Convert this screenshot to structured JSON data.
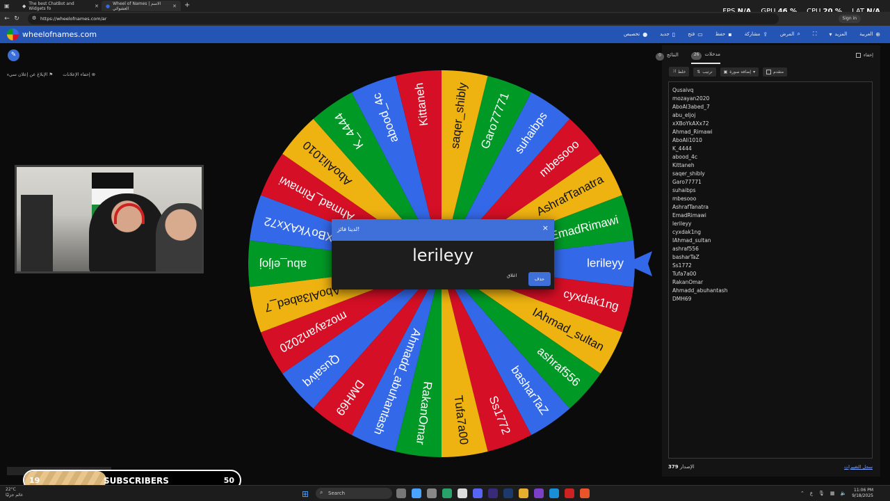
{
  "browser": {
    "tabs": [
      {
        "title": "The best ChatBot and Widgets fo",
        "active": false
      },
      {
        "title": "Wheel of Names | الاسم العشوائي",
        "active": true
      }
    ],
    "url": "https://wheelofnames.com/ar",
    "signin": "Sign in"
  },
  "overlay_stats": {
    "fps_label": "FPS",
    "fps_value": "N/A",
    "gpu_label": "GPU",
    "gpu_value": "46 %",
    "cpu_label": "CPU",
    "cpu_value": "20 %",
    "lat_label": "LAT",
    "lat_value": "N/A"
  },
  "site": {
    "title": "wheelofnames.com",
    "menu": [
      {
        "label": "العربية",
        "icon": "globe-icon"
      },
      {
        "label": "المزيد",
        "icon": "chevron-down-icon"
      },
      {
        "label": "",
        "icon": "fullscreen-icon"
      },
      {
        "label": "المرض",
        "icon": "search-icon"
      },
      {
        "label": "مشاركة",
        "icon": "share-icon"
      },
      {
        "label": "حفظ",
        "icon": "save-icon"
      },
      {
        "label": "فتح",
        "icon": "folder-icon"
      },
      {
        "label": "جديد",
        "icon": "file-icon"
      },
      {
        "label": "تخصيص",
        "icon": "palette-icon"
      }
    ]
  },
  "left": {
    "hide_ads": "إخفاء الإعلانات",
    "report_ad": "الإبلاغ عن إعلان سيء"
  },
  "wheel": {
    "colors": [
      "#3369e8",
      "#d50f25",
      "#eeb211",
      "#009925"
    ],
    "names": [
      "Qusaivq",
      "mozayan2020",
      "AboAl3abed_7",
      "abu_eljoj",
      "xXBoYkAXx72",
      "Ahmad_Rimawi",
      "AboAli1010",
      "K_4444",
      "abood_4c",
      "Kittaneh",
      "saqer_shibly",
      "Garo77771",
      "suhaibps",
      "mbesooo",
      "AshrafTanatra",
      "EmadRimawi",
      "lerileyy",
      "cyxdak1ng",
      "IAhmad_sultan",
      "ashraf556",
      "basharTaZ",
      "Ss1772",
      "Tufa7a00",
      "RakanOmar",
      "Ahmadd_abuhantash",
      "DMH69"
    ],
    "pointer_color": "#3369e8"
  },
  "dialog": {
    "title": "لدينا فائز!",
    "winner": "lerileyy",
    "close_label": "اغلاق",
    "remove_label": "حذف"
  },
  "panel": {
    "tab_entries": "مدخلات",
    "tab_entries_count": "26",
    "tab_results": "النتائج",
    "tab_results_count": "0",
    "hide_label": "إخفاء",
    "toolbar": {
      "shuffle": "خلط",
      "sort": "ترتيب",
      "add_image": "إضافة صورة",
      "advanced": "متقدم"
    },
    "names": [
      "Qusaivq",
      "mozayan2020",
      "AboAl3abed_7",
      "abu_eljoj",
      "xXBoYkAXx72",
      "Ahmad_Rimawi",
      "AboAli1010",
      "K_4444",
      "abood_4c",
      "Kittaneh",
      "saqer_shibly",
      "Garo77771",
      "suhaibps",
      "mbesooo",
      "AshrafTanatra",
      "EmadRimawi",
      "lerileyy",
      "cyxdak1ng",
      "IAhmad_sultan",
      "ashraf556",
      "basharTaZ",
      "Ss1772",
      "Tufa7a00",
      "RakanOmar",
      "Ahmadd_abuhantash",
      "DMH69"
    ],
    "version_label": "الإصدار",
    "version": "379",
    "history_link": "سجل التغييرات"
  },
  "subscribers": {
    "current": "19",
    "label": "SUBSCRIBERS",
    "goal": "50",
    "progress": 0.38
  },
  "taskbar": {
    "weather_temp": "22°C",
    "weather_desc": "غائم جزئيًا",
    "search": "Search",
    "lang": "ع",
    "time": "11:06 PM",
    "date": "9/18/2025"
  }
}
